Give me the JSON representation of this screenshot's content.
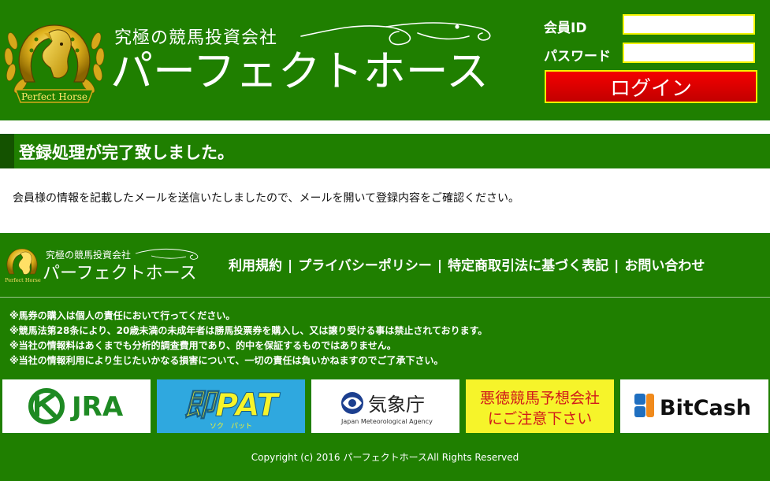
{
  "header": {
    "tagline": "究極の競馬投資会社",
    "brand_name": "パーフェクトホース",
    "emblem_text": "Perfect Horse",
    "login": {
      "id_label": "会員ID",
      "password_label": "パスワード",
      "id_value": "",
      "password_value": "",
      "button_label": "ログイン"
    }
  },
  "main": {
    "heading": "登録処理が完了致しました。",
    "message": "会員様の情報を記載したメールを送信いたしましたので、メールを開いて登録内容をご確認ください。"
  },
  "footer": {
    "tagline": "究極の競馬投資会社",
    "brand_name": "パーフェクトホース",
    "emblem_text": "Perfect Horse",
    "links": [
      "利用規約",
      "プライバシーポリシー",
      "特定商取引法に基づく表記",
      "お問い合わせ"
    ],
    "separator": "|",
    "notices": [
      "※馬券の購入は個人の責任において行ってください。",
      "※競馬法第28条により、20歳未満の未成年者は勝馬投票券を購入し、又は譲り受ける事は禁止されております。",
      "※当社の情報料はあくまでも分析的調査費用であり、的中を保証するものではありません。",
      "※当社の情報利用により生じたいかなる損害について、一切の責任は負いかねますのでご了承下さい。"
    ],
    "banners": {
      "jra": "JRA",
      "pat": "即PAT",
      "pat_sub": "ソク　パット",
      "jma_name": "気象庁",
      "jma_sub": "Japan Meteorological Agency",
      "warning_line1": "悪徳競馬予想会社",
      "warning_line2": "にご注意下さい",
      "bitcash": "BitCash"
    },
    "copyright": "Copyright (c) 2016 パーフェクトホースAll Rights Reserved"
  },
  "colors": {
    "brand_green": "#1f7f00",
    "heading_accent": "#145200",
    "login_red": "#e00000",
    "input_border": "#f4f400",
    "warning_yellow": "#f6f42a",
    "pat_blue": "#2fa8df"
  }
}
